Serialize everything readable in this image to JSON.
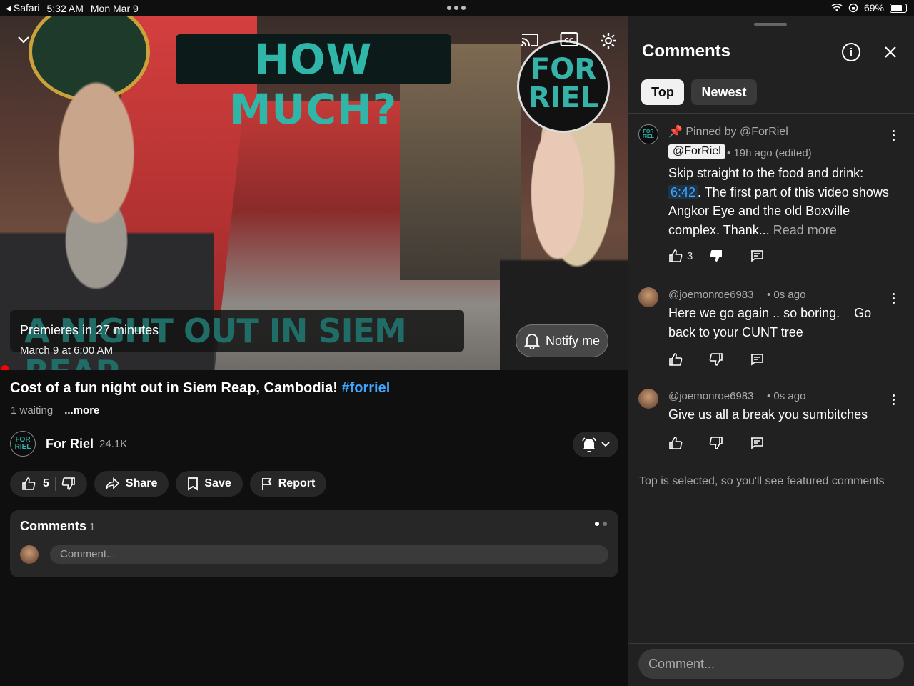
{
  "status_bar": {
    "back_app": "Safari",
    "time": "5:32 AM",
    "date": "Mon Mar 9",
    "battery": "69%"
  },
  "video": {
    "overlay_headline": "HOW MUCH?",
    "overlay_logo_line1": "FOR",
    "overlay_logo_line2": "RIEL",
    "overlay_subtitle": "A NIGHT OUT IN SIEM REAP",
    "premiere_title": "Premieres in 27 minutes",
    "premiere_date": "March 9 at 6:00 AM",
    "notify_label": "Notify me"
  },
  "details": {
    "title": "Cost of a fun night out in Siem Reap, Cambodia!",
    "hashtag": "#forriel",
    "waiting": "1 waiting",
    "more": "...more"
  },
  "channel": {
    "avatar_line1": "FOR",
    "avatar_line2": "RIEL",
    "name": "For Riel",
    "subscribers": "24.1K"
  },
  "actions": {
    "like_count": "5",
    "share": "Share",
    "save": "Save",
    "report": "Report"
  },
  "comments_card": {
    "title": "Comments",
    "count": "1",
    "placeholder": "Comment..."
  },
  "panel": {
    "title": "Comments",
    "chips": {
      "top": "Top",
      "newest": "Newest"
    },
    "comments": [
      {
        "pinned": "Pinned by @ForRiel",
        "author": "@ForRiel",
        "meta": "• 19h ago (edited)",
        "text_before": "Skip straight to the food and drink: ",
        "timestamp": "6:42",
        "text_after": ". The first part of this video shows Angkor Eye and the old Boxville complex. Thank...",
        "read_more": "Read more",
        "likes": "3"
      },
      {
        "author": "@joemonroe6983",
        "meta": "• 0s ago",
        "text": "Here we go again .. so boring.    Go back to your CUNT tree"
      },
      {
        "author": "@joemonroe6983",
        "meta": "• 0s ago",
        "text": "Give us all a break you sumbitches"
      }
    ],
    "footer_note": "Top is selected, so you'll see featured comments",
    "input_placeholder": "Comment..."
  },
  "colors": {
    "background": "#0f0f0f",
    "panel": "#212121",
    "accent_link": "#3ea6ff",
    "live_dot": "#ff0000"
  }
}
